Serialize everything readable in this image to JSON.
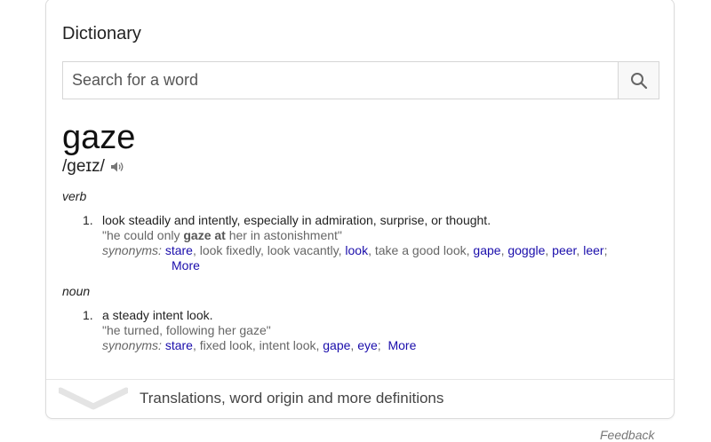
{
  "card": {
    "title": "Dictionary",
    "search": {
      "placeholder": "Search for a word",
      "value": "",
      "icon": "search-icon"
    },
    "entry": {
      "word": "gaze",
      "pronunciation": "/ɡeɪz/",
      "senses": [
        {
          "part_of_speech": "verb",
          "number": "1.",
          "definition": "look steadily and intently, especially in admiration, surprise, or thought.",
          "example_before": "\"he could only ",
          "example_bold": "gaze at",
          "example_after": " her in astonishment\"",
          "synonyms_label": "synonyms:",
          "synonyms": [
            {
              "text": "stare",
              "link": true
            },
            {
              "text": "look fixedly",
              "link": false
            },
            {
              "text": "look vacantly",
              "link": false
            },
            {
              "text": "look",
              "link": true
            },
            {
              "text": "take a good look",
              "link": false
            },
            {
              "text": "gape",
              "link": true
            },
            {
              "text": "goggle",
              "link": true
            },
            {
              "text": "peer",
              "link": true
            },
            {
              "text": "leer",
              "link": true
            }
          ],
          "more": "More"
        },
        {
          "part_of_speech": "noun",
          "number": "1.",
          "definition": "a steady intent look.",
          "example": "\"he turned, following her gaze\"",
          "synonyms_label": "synonyms:",
          "synonyms": [
            {
              "text": "stare",
              "link": true
            },
            {
              "text": "fixed look",
              "link": false
            },
            {
              "text": "intent look",
              "link": false
            },
            {
              "text": "gape",
              "link": true
            },
            {
              "text": "eye",
              "link": true
            }
          ],
          "more": "More"
        }
      ]
    },
    "expander_text": "Translations, word origin and more definitions"
  },
  "feedback": "Feedback",
  "colors": {
    "link": "#1a0dab",
    "muted": "#666666",
    "border": "#dcdcdc"
  }
}
